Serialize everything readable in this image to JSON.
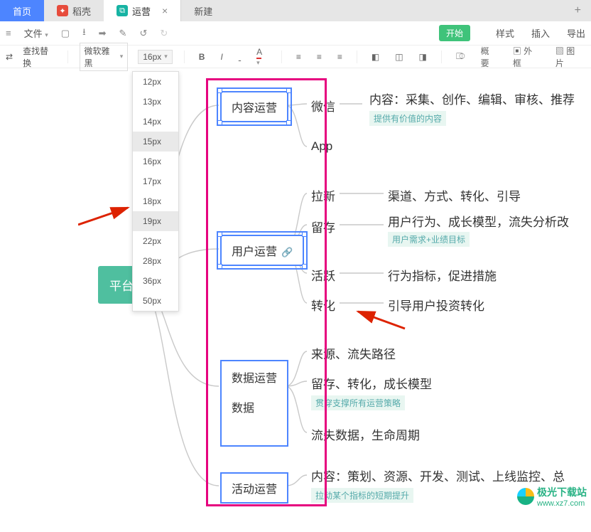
{
  "tabs": {
    "home": "首页",
    "second": "稻壳",
    "active": "运营",
    "new": "新建"
  },
  "menubar": {
    "file": "文件",
    "start": "开始",
    "style": "样式",
    "insert": "插入",
    "export": "导出"
  },
  "toolbar": {
    "find_replace": "查找替换",
    "font": "微软雅黑",
    "size": "16px",
    "outline": "概要",
    "frame": "外框",
    "image": "图片"
  },
  "size_options": [
    "12px",
    "13px",
    "14px",
    "15px",
    "16px",
    "17px",
    "18px",
    "19px",
    "22px",
    "28px",
    "36px",
    "50px"
  ],
  "size_hover": "19px",
  "size_hover2": "15px",
  "mindmap": {
    "root": "平台",
    "n1": "内容运营",
    "n1c1": "微信",
    "n1c1_desc": "内容：采集、创作、编辑、审核、推荐",
    "n1c1_tag": "提供有价值的内容",
    "n1c2": "App",
    "n2": "用户运营",
    "n2c1": "拉新",
    "n2c1_desc": "渠道、方式、转化、引导",
    "n2c2": "留存",
    "n2c2_desc": "用户行为、成长模型，流失分析改",
    "n2c2_tag": "用户需求+业绩目标",
    "n2c3": "活跃",
    "n2c3_desc": "行为指标，促进措施",
    "n2c4": "转化",
    "n2c4_desc": "引导用户投资转化",
    "n3a": "数据运营",
    "n3b": "数据",
    "n3c1": "来源、流失路径",
    "n3c2": "留存、转化，成长模型",
    "n3c2_tag": "贯穿支撑所有运营策略",
    "n3c3": "流失数据，生命周期",
    "n4": "活动运营",
    "n4c1": "内容：策划、资源、开发、测试、上线监控、总",
    "n4c1_tag": "拉动某个指标的短期提升"
  },
  "watermark": {
    "cn": "极光下载站",
    "url": "www.xz7.com"
  }
}
